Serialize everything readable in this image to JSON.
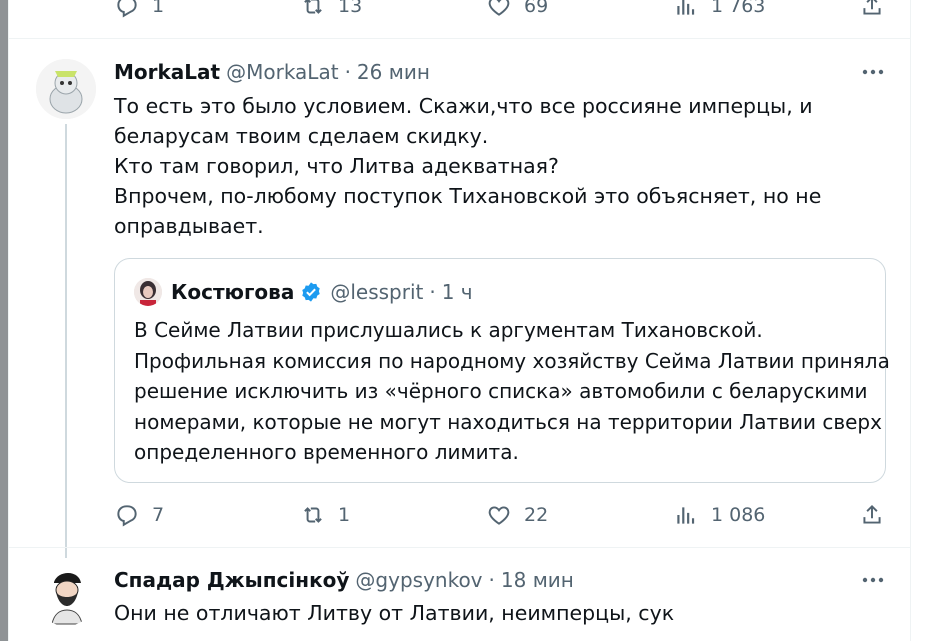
{
  "prev_tweet": {
    "replies": "1",
    "retweets": "13",
    "likes": "69",
    "views": "1 763"
  },
  "tweet1": {
    "display_name": "MorkaLat",
    "handle": "@MorkaLat",
    "separator": "·",
    "time": "26 мин",
    "lines": [
      "То есть это было условием. Скажи,что все россияне имперцы, и",
      "беларусам твоим сделаем скидку.",
      "Кто там говорил, что Литва адекватная?",
      "Впрочем, по-любому поступок Тихановской это объясняет, но не",
      "оправдывает."
    ],
    "quote": {
      "display_name": "Костюгова",
      "handle": "@lessprit",
      "separator": "·",
      "time": "1 ч",
      "lines": [
        "В Сейме Латвии прислушались к аргументам Тихановской.",
        "Профильная комиссия по народному хозяйству Сейма Латвии приняла",
        "решение исключить из «чёрного списка» автомобили с беларускими",
        "номерами, которые не могут находиться на территории Латвии сверх",
        "определенного временного лимита."
      ]
    },
    "replies": "7",
    "retweets": "1",
    "likes": "22",
    "views": "1 086"
  },
  "tweet2": {
    "display_name": "Спадар Джыпсінкоў",
    "handle": "@gypsynkov",
    "separator": "·",
    "time": "18 мин",
    "lines": [
      "Они не отличают Литву от Латвии, неимперцы, сук"
    ]
  },
  "colors": {
    "text": "#0f1419",
    "secondary": "#536471",
    "border": "#eff3f4",
    "verified": "#1d9bf0"
  },
  "icons": [
    "reply-icon",
    "retweet-icon",
    "like-icon",
    "views-icon",
    "share-icon",
    "more-icon",
    "verified-badge-icon"
  ]
}
